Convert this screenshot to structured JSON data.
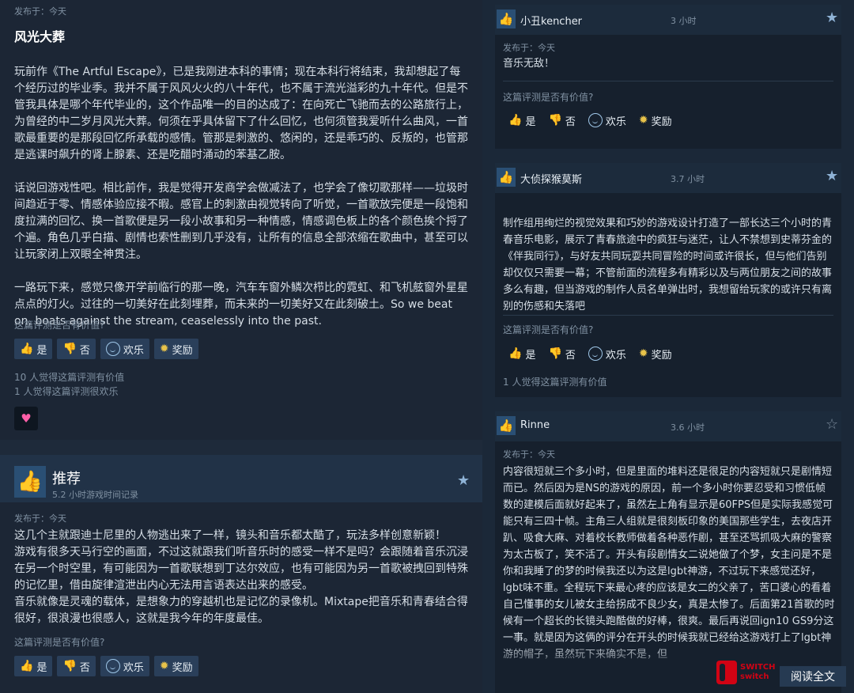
{
  "left": {
    "review1": {
      "posted": "发布于：今天",
      "title": "风光大葬",
      "paragraphs": [
        "玩前作《The Artful Escape》，已是我刚进本科的事情；现在本科行将结束，我却想起了每个经历过的毕业季。我并不属于风风火火的八十年代，也不属于流光溢彩的九十年代。但是不管我具体是哪个年代毕业的，这个作品唯一的目的达成了：在向死亡飞驰而去的公路旅行上，为曾经的中二岁月风光大葬。何须在乎具体留下了什么回忆，也何须管我爱听什么曲风，一首歌最重要的是那段回忆所承载的感情。管那是刺激的、悠闲的，还是乖巧的、反叛的，也管那是逃课时飙升的肾上腺素、还是吃醋时涌动的苯基乙胺。",
        "话说回游戏性吧。相比前作，我是觉得开发商学会做减法了，也学会了像切歌那样——垃圾时间趋近于零、情感体验应接不暇。感官上的刺激由视觉转向了听觉，一首歌放完便是一段饱和度拉满的回忆、换一首歌便是另一段小故事和另一种情感，情感调色板上的各个颜色挨个捋了个遍。角色几乎白描、剧情也索性删到几乎没有，让所有的信息全部浓缩在歌曲中，甚至可以让玩家闭上双眼全神贯注。",
        "一路玩下来，感觉只像开学前临行的那一晚，汽车车窗外鳞次栉比的霓虹、和飞机舷窗外星星点点的灯火。过往的一切美好在此刻埋葬，而未来的一切美好又在此刻破土。So we beat on, boats against the stream, ceaselessly into the past."
      ],
      "helpful_q": "这篇评测是否有价值?",
      "btn_yes": "是",
      "btn_no": "否",
      "btn_fun": "欢乐",
      "btn_award": "奖励",
      "stat1": "10 人觉得这篇评测有价值",
      "stat2": "1 人觉得这篇评测很欢乐",
      "award_emoji": "♥"
    },
    "review2": {
      "rec_title": "推荐",
      "hours": "5.2 小时游戏时间记录",
      "posted": "发布于：今天",
      "lines": [
        "这几个主就跟迪士尼里的人物逃出来了一样，镜头和音乐都太酷了，玩法多样创意新颖！",
        "游戏有很多天马行空的画面，不过这就跟我们听音乐时的感受一样不是吗？会跟随着音乐沉浸在另一个时空里，有可能因为一首歌联想到丁达尔效应，也有可能因为另一首歌被拽回到特殊的记忆里，借由旋律渲泄出内心无法用言语表达出来的感受。",
        "音乐就像是灵魂的载体，是想象力的穿越机也是记忆的录像机。Mixtape把音乐和青春结合得很好，很浪漫也很感人，这就是我今年的年度最佳。"
      ],
      "helpful_q": "这篇评测是否有价值?",
      "btn_yes": "是",
      "btn_no": "否",
      "btn_fun": "欢乐",
      "btn_award": "奖励"
    }
  },
  "right": {
    "r1": {
      "name": "小丑kencher",
      "hours": "3 小时",
      "posted": "发布于：今天",
      "text": "音乐无敌！",
      "helpful_q": "这篇评测是否有价值?",
      "btn_yes": "是",
      "btn_no": "否",
      "btn_fun": "欢乐",
      "btn_award": "奖励"
    },
    "r2": {
      "name": "大侦探猴莫斯",
      "hours": "3.7 小时",
      "text": "制作组用绚烂的视觉效果和巧妙的游戏设计打造了一部长达三个小时的青春音乐电影，展示了青春旅途中的疯狂与迷茫，让人不禁想到史蒂芬金的《伴我同行》，与好友共同玩耍共同冒险的时间或许很长，但与他们告别却仅仅只需要一幕；不管前面的流程多有精彩以及与两位朋友之间的故事多么有趣，但当游戏的制作人员名单弹出时，我想留给玩家的或许只有离别的伤感和失落吧",
      "helpful_q": "这篇评测是否有价值?",
      "btn_yes": "是",
      "btn_no": "否",
      "btn_fun": "欢乐",
      "btn_award": "奖励",
      "stat": "1 人觉得这篇评测有价值"
    },
    "r3": {
      "name": "Rinne",
      "hours": "3.6 小时",
      "posted": "发布于：今天",
      "text": "内容很短就三个多小时，但是里面的堆料还是很足的内容短就只是剧情短而已。然后因为是NS的游戏的原因，前一个多小时你要忍受和习惯低帧数的建模后面就好起来了，虽然左上角有显示是60FPS但是实际我感觉可能只有三四十帧。主角三人组就是很刻板印象的美国那些学生，去夜店开趴、吸食大麻、对着校长教师做着各种恶作剧，甚至还骂抓吸大麻的警察为太古板了，笑不活了。开头有段剧情女二说她做了个梦，女主问是不是你和我睡了的梦的时候我还以为这是lgbt神游，不过玩下来感觉还好，lgbt味不重。全程玩下来最心疼的应该是女二的父亲了，苦口婆心的看着自己懂事的女儿被女主给拐成不良少女，真是太惨了。后面第21首歌的时候有一个超长的长镜头跑酷做的好棒，很爽。最后再说回ign10 GS9分这一事。就是因为这俩的评分在开头的时候我就已经给这游戏打上了lgbt神游的帽子，虽然玩下来确实不是，但",
      "read_more": "阅读全文"
    }
  },
  "watermark": {
    "line1": "SWITCH",
    "line2": "switch"
  }
}
